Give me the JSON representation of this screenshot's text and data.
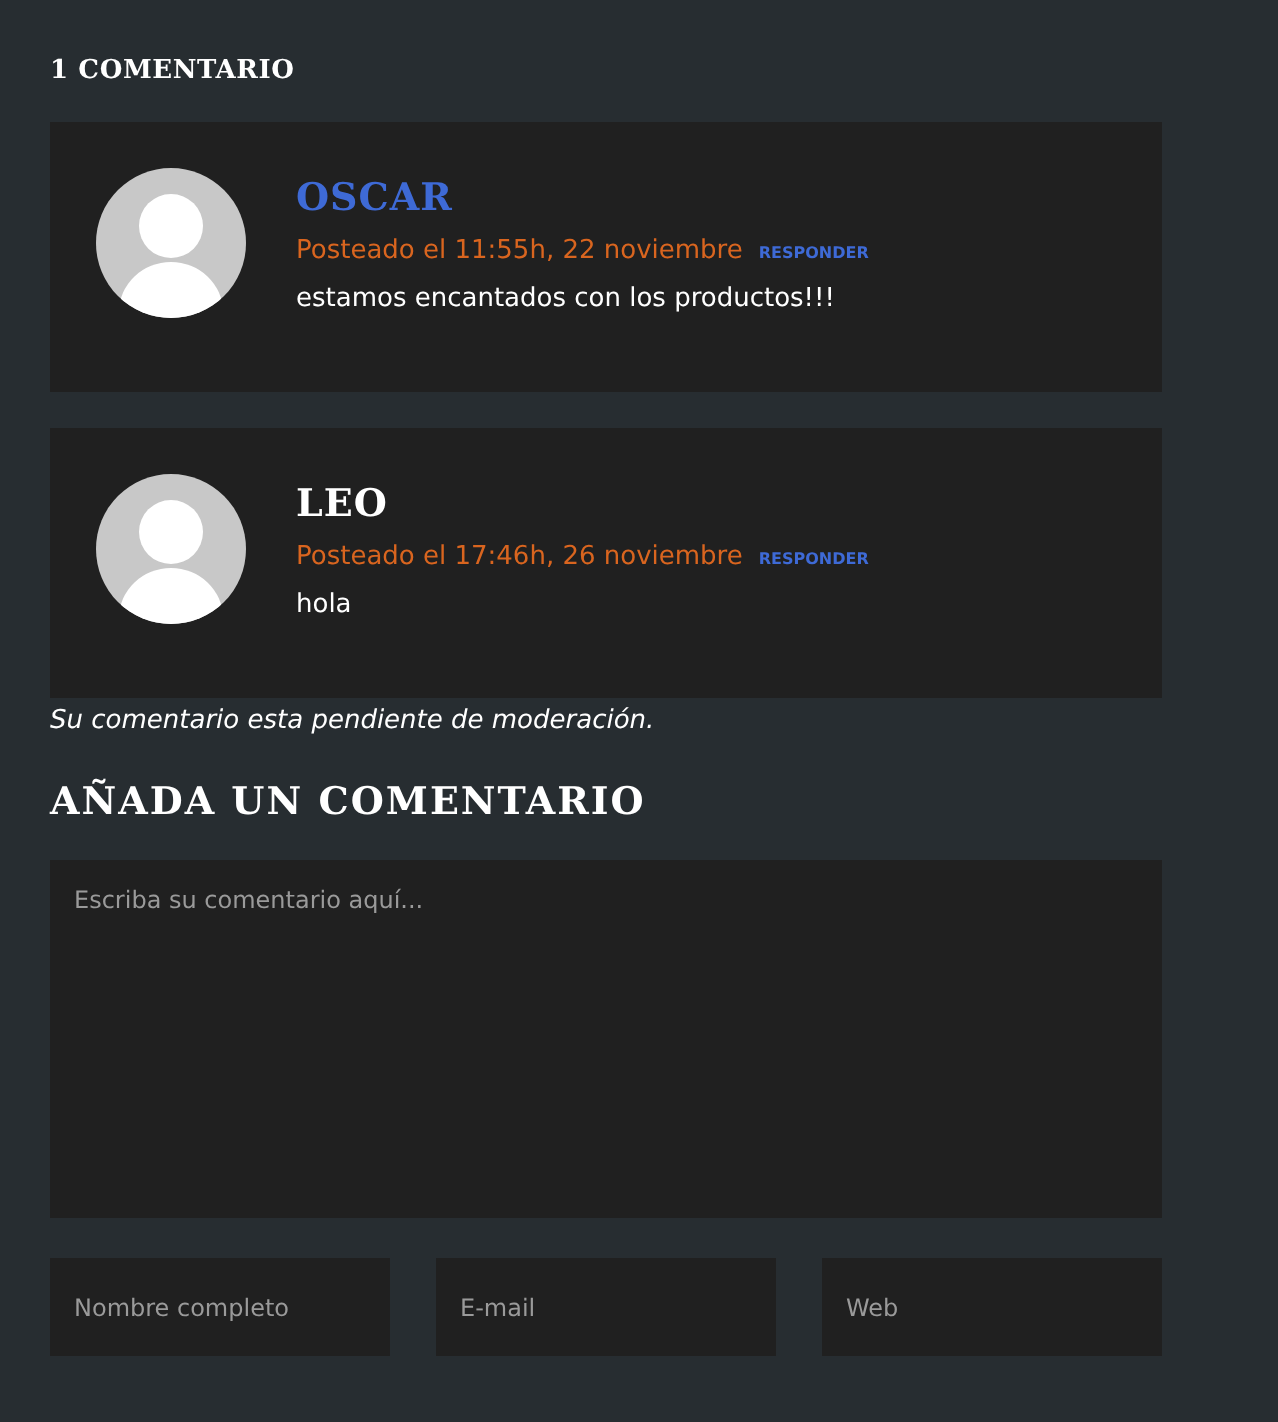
{
  "comments_heading": "1 COMENTARIO",
  "comments": [
    {
      "author": "OSCAR",
      "author_is_link": true,
      "meta": "Posteado el 11:55h, 22 noviembre",
      "reply": "RESPONDER",
      "text": "estamos encantados con los productos!!!"
    },
    {
      "author": "LEO",
      "author_is_link": false,
      "meta": "Posteado el 17:46h, 26 noviembre",
      "reply": "RESPONDER",
      "text": "hola",
      "note": "Su comentario esta pendiente de moderación."
    }
  ],
  "form": {
    "heading": "AÑADA UN COMENTARIO",
    "comment": {
      "placeholder": "Escriba su comentario aquí..."
    },
    "fields": [
      {
        "placeholder": "Nombre completo"
      },
      {
        "placeholder": "E-mail"
      },
      {
        "placeholder": "Web"
      }
    ]
  }
}
